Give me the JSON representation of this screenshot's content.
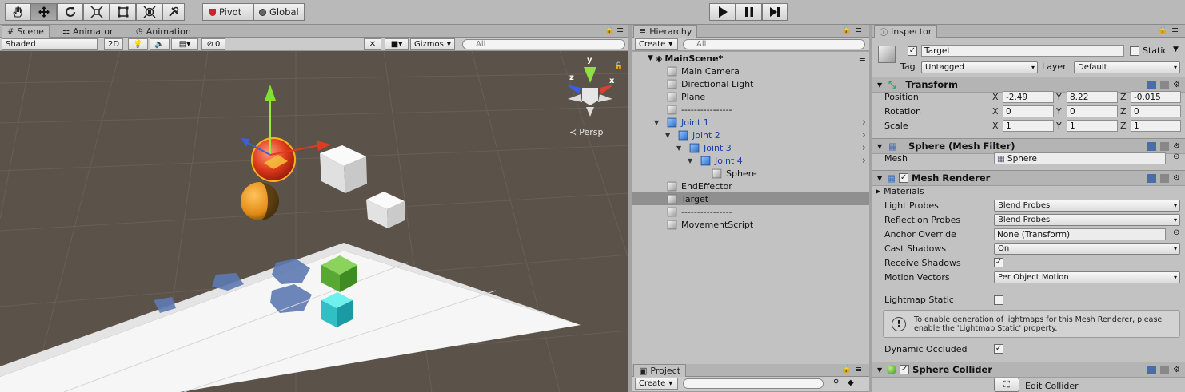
{
  "toolbar": {
    "pivot_label": "Pivot",
    "global_label": "Global",
    "tools": [
      "hand-tool",
      "move-tool",
      "rotate-tool",
      "scale-tool",
      "rect-tool",
      "transform-tool",
      "custom-tool"
    ]
  },
  "scene": {
    "tabs": [
      {
        "label": "Scene",
        "icon": "grid-icon"
      },
      {
        "label": "Animator",
        "icon": "animator-icon"
      },
      {
        "label": "Animation",
        "icon": "clock-icon"
      }
    ],
    "shading": "Shaded",
    "mode_2d": "2D",
    "hidden_count": "0",
    "gizmos": "Gizmos",
    "search_placeholder": "All",
    "persp_label": "Persp",
    "axis_labels": {
      "x": "x",
      "y": "y",
      "z": "z"
    }
  },
  "hierarchy": {
    "title": "Hierarchy",
    "create_label": "Create",
    "search_placeholder": "All",
    "scene_name": "MainScene*",
    "items": [
      {
        "label": "Main Camera",
        "depth": 0,
        "color": "#111"
      },
      {
        "label": "Directional Light",
        "depth": 0,
        "color": "#111"
      },
      {
        "label": "Plane",
        "depth": 0,
        "color": "#111"
      },
      {
        "label": "----------------",
        "depth": 0,
        "color": "#111"
      },
      {
        "label": "Joint 1",
        "depth": 0,
        "color": "#1a3fa8",
        "arrow": true,
        "prefab": true
      },
      {
        "label": "Joint 2",
        "depth": 1,
        "color": "#1a3fa8",
        "arrow": true,
        "prefab": true
      },
      {
        "label": "Joint 3",
        "depth": 2,
        "color": "#1a3fa8",
        "arrow": true,
        "prefab": true
      },
      {
        "label": "Joint 4",
        "depth": 3,
        "color": "#1a3fa8",
        "arrow": true,
        "prefab": true
      },
      {
        "label": "Sphere",
        "depth": 4,
        "color": "#111"
      },
      {
        "label": "EndEffector",
        "depth": 0,
        "color": "#111"
      },
      {
        "label": "Target",
        "depth": 0,
        "color": "#111",
        "selected": true
      },
      {
        "label": "----------------",
        "depth": 0,
        "color": "#111"
      },
      {
        "label": "MovementScript",
        "depth": 0,
        "color": "#111"
      }
    ]
  },
  "project": {
    "title": "Project",
    "create_label": "Create"
  },
  "inspector": {
    "title": "Inspector",
    "object_name": "Target",
    "static_label": "Static",
    "tag_label": "Tag",
    "tag_value": "Untagged",
    "layer_label": "Layer",
    "layer_value": "Default",
    "transform": {
      "title": "Transform",
      "position_label": "Position",
      "rotation_label": "Rotation",
      "scale_label": "Scale",
      "position": {
        "x": "-2.49",
        "y": "8.22",
        "z": "-0.015"
      },
      "rotation": {
        "x": "0",
        "y": "0",
        "z": "0"
      },
      "scale": {
        "x": "1",
        "y": "1",
        "z": "1"
      }
    },
    "mesh_filter": {
      "title": "Sphere (Mesh Filter)",
      "mesh_label": "Mesh",
      "mesh_value": "Sphere"
    },
    "mesh_renderer": {
      "title": "Mesh Renderer",
      "materials_label": "Materials",
      "light_probes_label": "Light Probes",
      "light_probes_value": "Blend Probes",
      "reflection_probes_label": "Reflection Probes",
      "reflection_probes_value": "Blend Probes",
      "anchor_override_label": "Anchor Override",
      "anchor_override_value": "None (Transform)",
      "cast_shadows_label": "Cast Shadows",
      "cast_shadows_value": "On",
      "receive_shadows_label": "Receive Shadows",
      "motion_vectors_label": "Motion Vectors",
      "motion_vectors_value": "Per Object Motion",
      "lightmap_static_label": "Lightmap Static",
      "info_text": "To enable generation of lightmaps for this Mesh Renderer, please enable the 'Lightmap Static' property.",
      "dynamic_occluded_label": "Dynamic Occluded"
    },
    "sphere_collider": {
      "title": "Sphere Collider",
      "edit_label": "Edit Collider"
    }
  },
  "colors": {
    "selection": "#8f8f8f",
    "prefab_text": "#1a3fa8",
    "scene_bg": "#5b5249",
    "panel_bg": "#c2c2c2"
  }
}
